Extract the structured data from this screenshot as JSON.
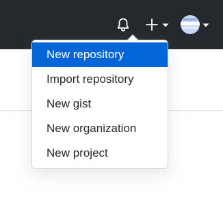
{
  "header": {
    "background_color": "#24292e",
    "icons": [
      "bell-icon",
      "plus-icon",
      "caret-down-icon",
      "avatar",
      "caret-down-icon"
    ]
  },
  "dropdown": {
    "items": [
      {
        "label": "New repository",
        "active": true
      },
      {
        "label": "Import repository",
        "active": false
      },
      {
        "label": "New gist",
        "active": false
      },
      {
        "label": "New organization",
        "active": false
      },
      {
        "label": "New project",
        "active": false
      }
    ],
    "active_color": "#0366d6"
  }
}
